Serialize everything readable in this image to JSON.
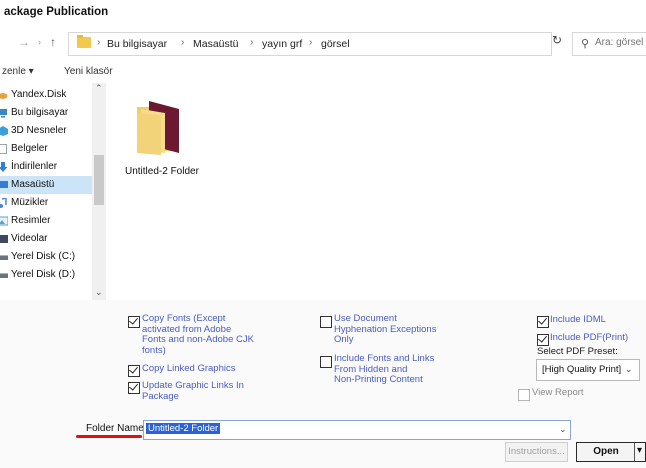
{
  "window": {
    "title": "ackage Publication"
  },
  "address": {
    "back_icon": "back-arrow-icon",
    "forward_icon": "forward-arrow-icon",
    "up_icon": "up-arrow-icon",
    "crumbs": [
      "Bu bilgisayar",
      "Masaüstü",
      "yayın grf",
      "görsel"
    ],
    "search_placeholder": "Ara: görsel"
  },
  "toolbar": {
    "organize": "zenle ▾",
    "new_folder": "Yeni klasör"
  },
  "sidebar": {
    "items": [
      {
        "label": "Yandex.Disk",
        "icon": "cloud-icon",
        "color": "#e8a33c"
      },
      {
        "label": "Bu bilgisayar",
        "icon": "computer-icon",
        "color": "#3c84c8"
      },
      {
        "label": "3D Nesneler",
        "icon": "cube-icon",
        "color": "#39a0d8"
      },
      {
        "label": "Belgeler",
        "icon": "document-icon",
        "color": "#9aa4b0"
      },
      {
        "label": "İndirilenler",
        "icon": "download-icon",
        "color": "#2f7ed8"
      },
      {
        "label": "Masaüstü",
        "icon": "desktop-icon",
        "color": "#2f7ed8"
      },
      {
        "label": "Müzikler",
        "icon": "music-icon",
        "color": "#4a84d4"
      },
      {
        "label": "Resimler",
        "icon": "picture-icon",
        "color": "#56a0d0"
      },
      {
        "label": "Videolar",
        "icon": "video-icon",
        "color": "#3c4a5c"
      },
      {
        "label": "Yerel Disk (C:)",
        "icon": "drive-icon",
        "color": "#6a7480"
      },
      {
        "label": "Yerel Disk (D:)",
        "icon": "drive-icon",
        "color": "#6a7480"
      }
    ],
    "selected_index": 5
  },
  "files": [
    {
      "name": "Untitled-2 Folder",
      "icon": "folder-icon"
    }
  ],
  "options": {
    "copy_fonts": {
      "lines": [
        "Copy Fonts (Except",
        "activated from Adobe",
        "Fonts and non-Adobe CJK",
        "fonts)"
      ],
      "checked": true
    },
    "copy_linked": {
      "lines": [
        "Copy Linked Graphics"
      ],
      "checked": true
    },
    "update_links": {
      "lines": [
        "Update Graphic Links In",
        "Package"
      ],
      "checked": true
    },
    "use_hyphenation": {
      "lines": [
        "Use Document",
        "Hyphenation Exceptions",
        "Only"
      ],
      "checked": false
    },
    "include_hidden_fonts": {
      "lines": [
        "Include Fonts and Links",
        "From Hidden and",
        "Non-Printing Content"
      ],
      "checked": false
    },
    "include_idml": {
      "label": "Include IDML",
      "checked": true
    },
    "include_pdf": {
      "label": "Include PDF(Print)",
      "checked": true
    },
    "preset_label": "Select PDF Preset:",
    "preset_value": "[High Quality Print]",
    "view_report": {
      "label": "View Report",
      "checked": false
    }
  },
  "folder_name": {
    "label": "Folder Name",
    "value": "Untitled-2 Folder"
  },
  "buttons": {
    "instructions": "Instructions...",
    "open": "Open"
  },
  "colors": {
    "accent": "#2b62d8",
    "option_link": "#4a5cc9",
    "underline": "#e01010",
    "selected_nav": "#cce4f7"
  }
}
